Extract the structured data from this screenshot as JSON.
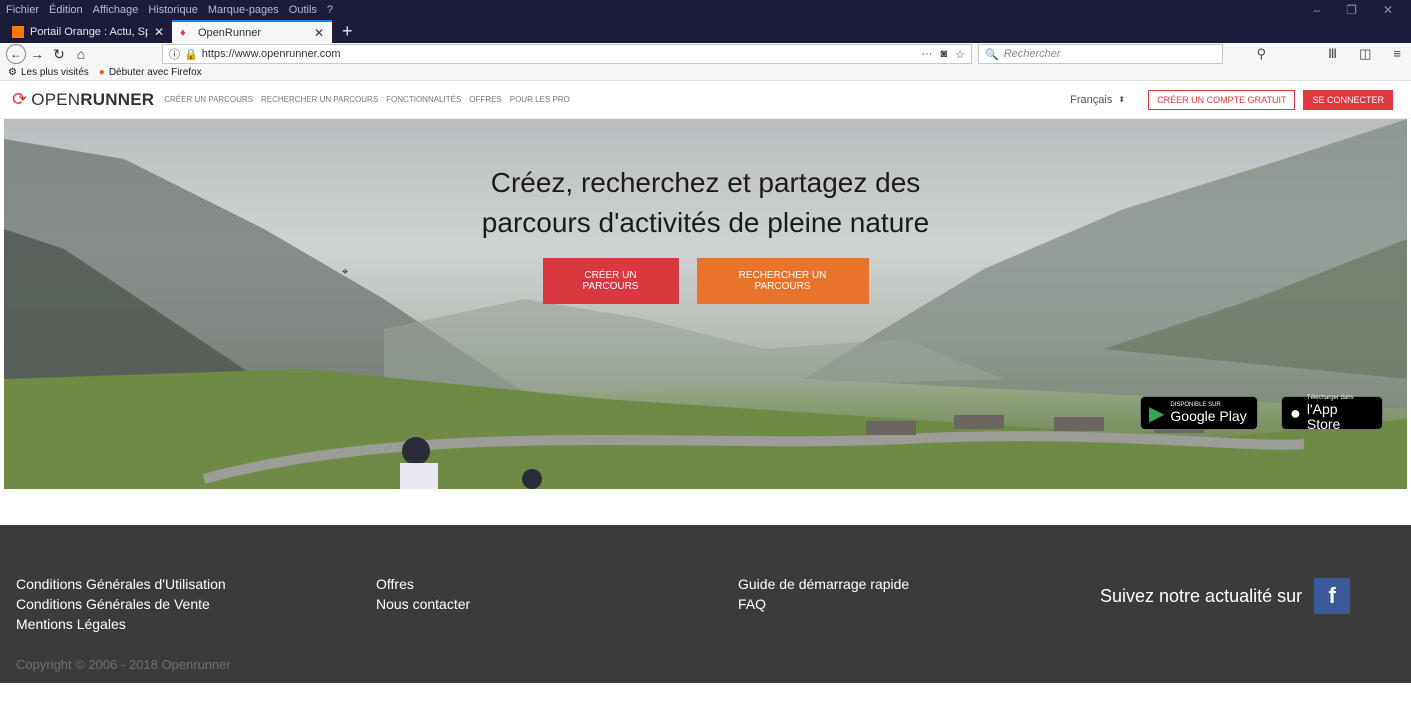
{
  "browser": {
    "menu": [
      "Fichier",
      "Édition",
      "Affichage",
      "Historique",
      "Marque-pages",
      "Outils",
      "?"
    ],
    "tabs": [
      {
        "label": "Portail Orange : Actu, Sport, Au"
      },
      {
        "label": "OpenRunner"
      }
    ],
    "url": "https://www.openrunner.com",
    "search_placeholder": "Rechercher",
    "bookmarks": [
      "Les plus visités",
      "Débuter avec Firefox"
    ]
  },
  "site": {
    "logo_light": "OPEN",
    "logo_bold": "RUNNER",
    "nav": [
      "CRÉER UN PARCOURS",
      "RECHERCHER UN PARCOURS",
      "FONCTIONNALITÉS",
      "OFFRES",
      "POUR LES PRO"
    ],
    "language": "Français",
    "create_account": "CRÉER UN COMPTE GRATUIT",
    "login": "SE CONNECTER"
  },
  "hero": {
    "title_line1": "Créez, recherchez et partagez des",
    "title_line2": "parcours d'activités de pleine nature",
    "cta_create": "CRÉER UN PARCOURS",
    "cta_search": "RECHERCHER UN PARCOURS",
    "google_play_small": "DISPONIBLE SUR",
    "google_play_big": "Google Play",
    "app_store_small": "Télécharger dans",
    "app_store_big": "l'App Store"
  },
  "footer": {
    "col1": [
      "Conditions Générales d'Utilisation",
      "Conditions Générales de Vente",
      "Mentions Légales"
    ],
    "col2": [
      "Offres",
      "Nous contacter"
    ],
    "col3": [
      "Guide de démarrage rapide",
      "FAQ"
    ],
    "follow": "Suivez notre actualité sur",
    "copyright": "Copyright © 2006 - 2018 Openrunner"
  }
}
